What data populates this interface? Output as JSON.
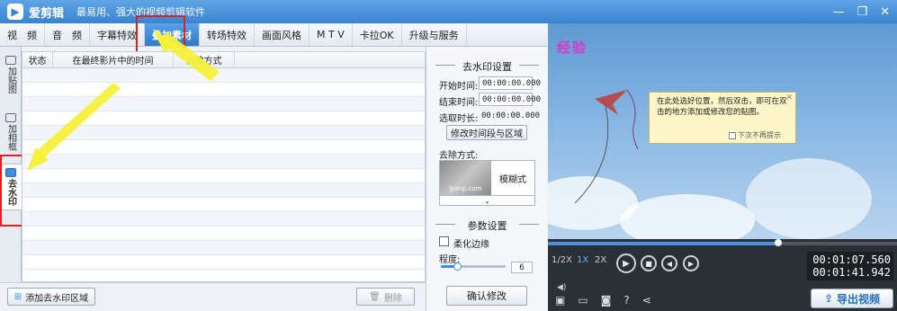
{
  "app": {
    "logo_glyph": "▶",
    "name": "爱剪辑",
    "slogan": "最易用、强大的视频剪辑软件",
    "window_controls": [
      "—",
      "❐",
      "✕"
    ]
  },
  "tabs": [
    {
      "label": "视　频",
      "active": false
    },
    {
      "label": "音　频",
      "active": false
    },
    {
      "label": "字幕特效",
      "active": false
    },
    {
      "label": "叠加素材",
      "active": true
    },
    {
      "label": "转场特效",
      "active": false
    },
    {
      "label": "画面风格",
      "active": false
    },
    {
      "label": "M T V",
      "active": false
    },
    {
      "label": "卡拉OK",
      "active": false
    },
    {
      "label": "升级与服务",
      "active": false
    }
  ],
  "side_toolbar": [
    {
      "label": "加贴图",
      "icon": "sticker-icon",
      "active": false
    },
    {
      "label": "加相框",
      "icon": "frame-icon",
      "active": false
    },
    {
      "label": "去水印",
      "icon": "watermark-icon",
      "active": true
    }
  ],
  "table": {
    "headers": [
      "状态",
      "在最终影片中的时间",
      "去除方式"
    ]
  },
  "bottom": {
    "add_button": "添加去水印区域",
    "delete_button": "删除"
  },
  "settings": {
    "title": "去水印设置",
    "start_label": "开始时间:",
    "start_value": "00:00:00.000",
    "end_label": "结束时间:",
    "end_value": "00:00:00.000",
    "duration_label": "选取时长:",
    "duration_value": "00:00:00.000",
    "modify_button": "修改时间段与区域",
    "method_label": "去除方式:",
    "method_thumb_text": "IJianJi.com",
    "method_name": "模糊式",
    "param_title": "参数设置",
    "soften_label": "柔化边缘",
    "degree_label": "程度:",
    "degree_value": "6",
    "degree_level": 0.25,
    "confirm_button": "确认修改"
  },
  "preview": {
    "watermark_text": "经验",
    "tooltip_text": "在此处选好位置，然后双击，即可在双击的地方添加或修改您的贴图。",
    "tooltip_checkbox": "下次不再提示"
  },
  "player": {
    "progress": 0.66,
    "speeds": [
      {
        "label": "1/2X",
        "active": false
      },
      {
        "label": "1X",
        "active": true
      },
      {
        "label": "2X",
        "active": false
      }
    ],
    "current_time": "00:01:07.560",
    "total_time": "00:01:41.942",
    "export_button": "导出视频"
  },
  "colors": {
    "accent": "#3a83cf",
    "highlight": "#e02020",
    "arrow": "#f5f03a",
    "watermark": "#d43bc8"
  }
}
